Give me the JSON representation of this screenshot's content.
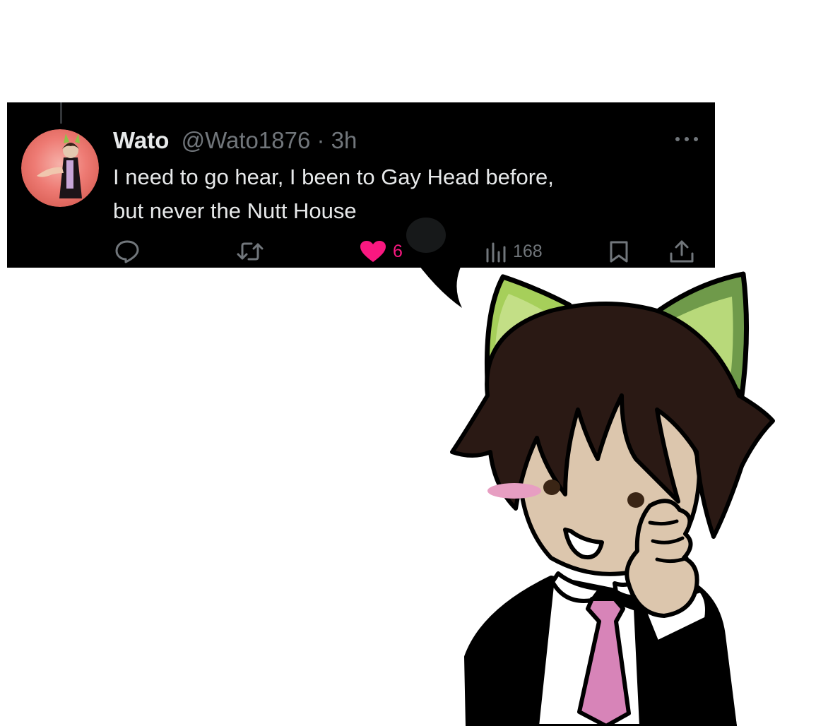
{
  "tweet": {
    "display_name": "Wato",
    "handle": "@Wato1876",
    "separator": "·",
    "time": "3h",
    "text_lines": [
      "I need to go hear, I been to Gay Head before,",
      "but never the Nutt House"
    ],
    "more_icon": "more-dots-icon",
    "actions": {
      "reply": {
        "icon": "reply-icon"
      },
      "retweet": {
        "icon": "retweet-icon"
      },
      "like": {
        "icon": "heart-icon",
        "count": "6",
        "color": "#f91880"
      },
      "views": {
        "icon": "views-icon",
        "count": "168"
      },
      "bookmark": {
        "icon": "bookmark-icon"
      },
      "share": {
        "icon": "share-icon"
      }
    }
  },
  "colors": {
    "tweet_bg": "#000000",
    "primary_text": "#e7e9ea",
    "secondary_text": "#71767b",
    "like_pink": "#f91880",
    "cat_ear_green": "#a6cf5a",
    "hair_brown": "#2a1914",
    "skin": "#dcc6ad",
    "tie_pink": "#d784b8",
    "blush_pink": "#e79ec2"
  }
}
